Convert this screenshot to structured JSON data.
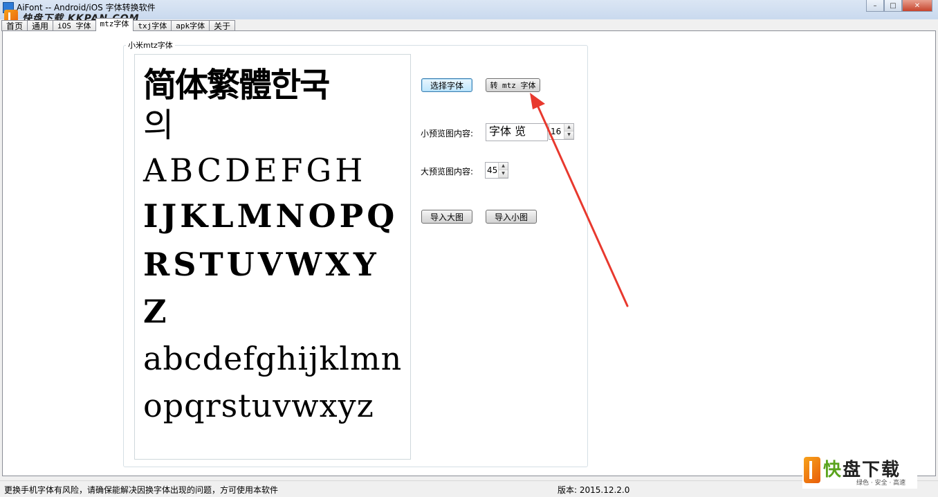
{
  "window": {
    "title": "AiFont -- Android/iOS 字体转换软件",
    "watermark_top": "快盘下载  KKPAN.COM",
    "controls": {
      "minimize": "–",
      "maximize": "□",
      "close": "✕"
    }
  },
  "tabs": [
    {
      "label": "首页"
    },
    {
      "label": "通用"
    },
    {
      "label": "iOS 字体"
    },
    {
      "label": "mtz字体",
      "active": true
    },
    {
      "label": "txj字体"
    },
    {
      "label": "apk字体"
    },
    {
      "label": "关于"
    }
  ],
  "panel": {
    "group_title": "小米mtz字体",
    "preview_lines": [
      "简体繁體한국",
      "의",
      "ABCDEFGH",
      "IJKLMNOPQ",
      "RSTUVWXY",
      "Z",
      "abcdefghijklmn",
      "opqrstuvwxyz"
    ],
    "buttons": {
      "select_font": "选择字体",
      "convert_mtz": "转 mtz 字体",
      "import_large": "导入大图",
      "import_small": "导入小图"
    },
    "small_preview": {
      "label": "小预览图内容:",
      "value": "字体  览",
      "size": "16"
    },
    "large_preview": {
      "label": "大预览图内容:",
      "size": "45"
    }
  },
  "status": {
    "warning": "更换手机字体有风险，请确保能解决因换字体出现的问题，方可使用本软件",
    "version": "版本: 2015.12.2.0"
  },
  "watermark_bottom": {
    "title_accent": "快",
    "title_rest": "盘下载",
    "subtitle": "绿色 · 安全 · 高速"
  },
  "colors": {
    "annotation_arrow": "#e8392e",
    "tab_border": "#898c95",
    "focus_border": "#3c7fb1"
  }
}
